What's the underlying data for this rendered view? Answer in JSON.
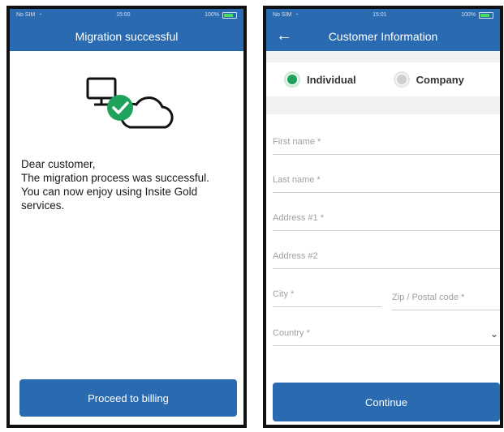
{
  "left_screen": {
    "status_bar": {
      "carrier": "No SIM",
      "time": "15:00",
      "battery": "100%"
    },
    "title": "Migration successful",
    "message_lines": [
      "Dear customer,",
      "The migration process was successful.",
      "You can now enjoy using Insite Gold",
      "services."
    ],
    "button_label": "Proceed to billing",
    "accent_color": "#2a6ab0",
    "check_color": "#1fa35c",
    "illustration_icons": [
      "computer-monitor-icon",
      "check-circle-icon",
      "cloud-icon"
    ]
  },
  "right_screen": {
    "status_bar": {
      "carrier": "No SIM",
      "time": "15:01",
      "battery": "100%"
    },
    "title": "Customer Information",
    "back_icon": "back-arrow-icon",
    "customer_type": {
      "options": [
        {
          "label": "Individual",
          "selected": true
        },
        {
          "label": "Company",
          "selected": false
        }
      ]
    },
    "fields": {
      "first_name": "First name *",
      "last_name": "Last name *",
      "address1": "Address #1 *",
      "address2": "Address #2",
      "city": "City *",
      "zip": "Zip / Postal code *",
      "country": "Country *"
    },
    "button_label": "Continue"
  }
}
